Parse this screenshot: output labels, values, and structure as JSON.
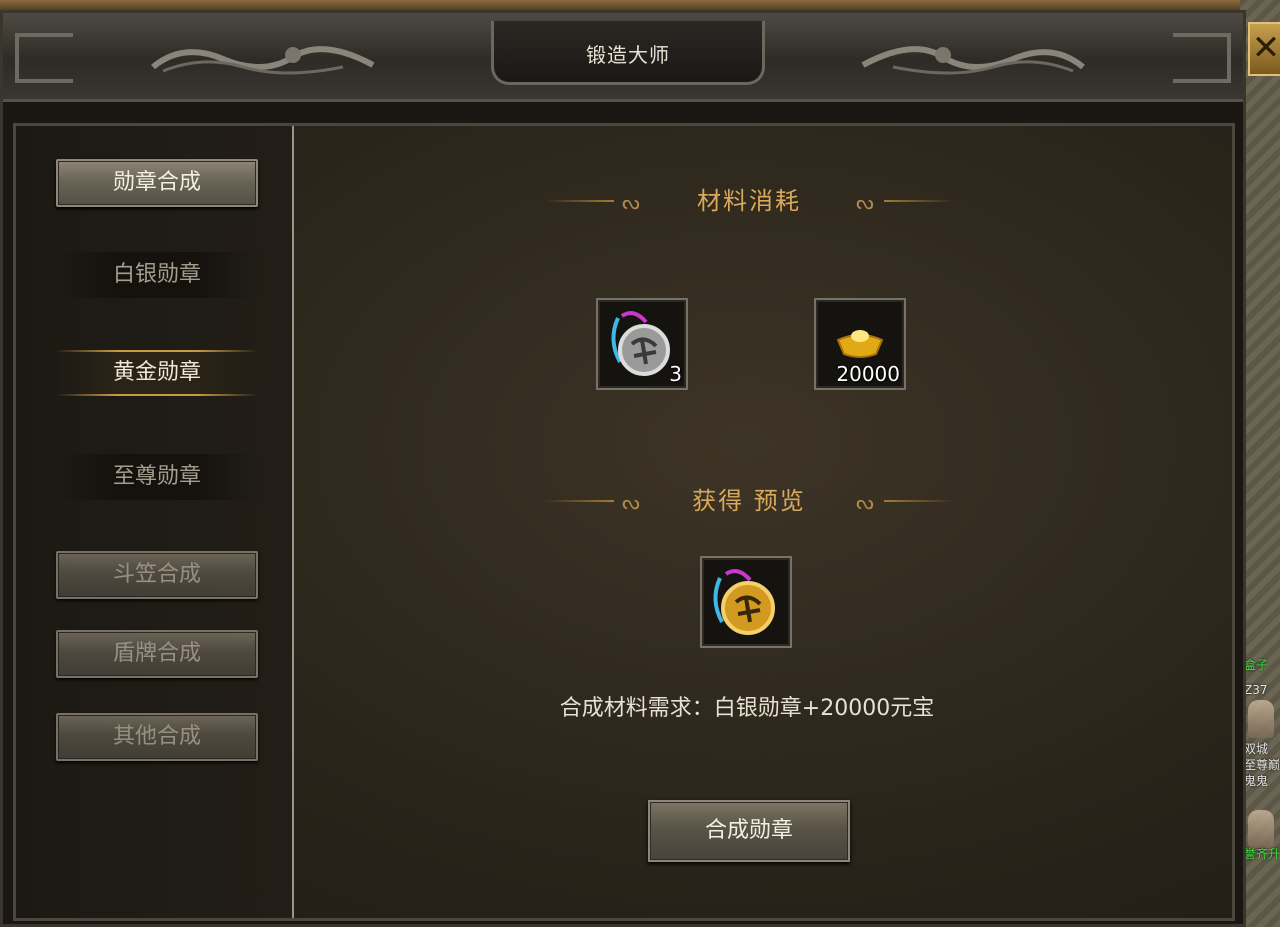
{
  "window": {
    "title": "锻造大师",
    "close_symbol": "✕"
  },
  "sidebar": {
    "categories": [
      {
        "label": "勋章合成",
        "state": "active"
      },
      {
        "label": "斗笠合成",
        "state": "disabled"
      },
      {
        "label": "盾牌合成",
        "state": "disabled"
      },
      {
        "label": "其他合成",
        "state": "disabled"
      }
    ],
    "sub_items": [
      {
        "label": "白银勋章",
        "selected": false
      },
      {
        "label": "黄金勋章",
        "selected": true
      },
      {
        "label": "至尊勋章",
        "selected": false
      }
    ]
  },
  "main": {
    "materials_heading": "材料消耗",
    "materials": [
      {
        "icon": "silver-medal-icon",
        "quantity": "3"
      },
      {
        "icon": "gold-ingot-icon",
        "quantity": "20000"
      }
    ],
    "preview_heading": "获得 预览",
    "preview_item": {
      "icon": "gold-medal-icon"
    },
    "requirement_text": "合成材料需求：白银勋章+20000元宝",
    "craft_button_label": "合成勋章"
  },
  "world_labels": [
    "盒子",
    "Z37",
    "双城",
    "至尊巅",
    "鬼鬼",
    "誉齐升"
  ],
  "colors": {
    "heading_gold": "#d9a95b",
    "frame_gray": "#787266",
    "close_gold": "#c7a04c"
  }
}
